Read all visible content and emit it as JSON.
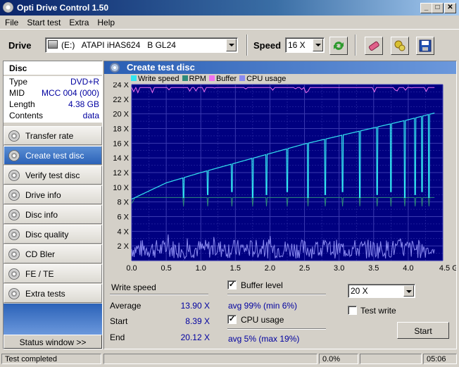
{
  "window": {
    "title": "Opti Drive Control 1.50",
    "controls": [
      "_",
      "□",
      "✕"
    ]
  },
  "menu": [
    "File",
    "Start test",
    "Extra",
    "Help"
  ],
  "toolbar": {
    "drive_label": "Drive",
    "drive_value": "(E:)   ATAPI iHAS624   B GL24",
    "speed_label": "Speed",
    "speed_value": "16 X"
  },
  "disc": {
    "header": "Disc",
    "rows": [
      {
        "key": "Type",
        "value": "DVD+R"
      },
      {
        "key": "MID",
        "value": "MCC 004 (000)"
      },
      {
        "key": "Length",
        "value": "4.38 GB"
      },
      {
        "key": "Contents",
        "value": "data"
      }
    ]
  },
  "nav": [
    {
      "label": "Transfer rate",
      "active": false
    },
    {
      "label": "Create test disc",
      "active": true
    },
    {
      "label": "Verify test disc",
      "active": false
    },
    {
      "label": "Drive info",
      "active": false
    },
    {
      "label": "Disc info",
      "active": false
    },
    {
      "label": "Disc quality",
      "active": false
    },
    {
      "label": "CD Bler",
      "active": false
    },
    {
      "label": "FE / TE",
      "active": false
    },
    {
      "label": "Extra tests",
      "active": false
    }
  ],
  "status_window_label": "Status window >>",
  "main": {
    "title": "Create test disc",
    "legend": [
      {
        "name": "Write speed",
        "color": "#33e5f0"
      },
      {
        "name": "RPM",
        "color": "#2e8a7a"
      },
      {
        "name": "Buffer",
        "color": "#f070f0"
      },
      {
        "name": "CPU usage",
        "color": "#8a8af0"
      }
    ]
  },
  "chart_data": {
    "type": "line",
    "x_axis": {
      "min": 0,
      "max": 4.5,
      "ticks": [
        "0.0",
        "0.5",
        "1.0",
        "1.5",
        "2.0",
        "2.5",
        "3.0",
        "3.5",
        "4.0",
        "4.5 GB"
      ]
    },
    "y_axis": {
      "min": 0,
      "max": 24,
      "ticks": [
        "2 X",
        "4 X",
        "6 X",
        "8 X",
        "10 X",
        "12 X",
        "14 X",
        "16 X",
        "18 X",
        "20 X",
        "22 X",
        "24 X"
      ]
    },
    "grid": true,
    "background": "#000080",
    "series": [
      {
        "name": "Write speed",
        "color": "#33e5f0",
        "x": [
          0.0,
          0.05,
          0.5,
          1.0,
          1.5,
          2.0,
          2.5,
          3.0,
          3.5,
          4.0,
          4.38
        ],
        "values": [
          8.39,
          8.6,
          10.6,
          12.0,
          13.3,
          14.6,
          15.9,
          17.0,
          18.1,
          19.2,
          20.12
        ]
      },
      {
        "name": "RPM",
        "color": "#2e8a7a",
        "x": [
          0.0,
          0.05,
          4.38
        ],
        "values": [
          7.8,
          8.6,
          8.6
        ]
      },
      {
        "name": "Buffer",
        "color": "#f070f0",
        "x": [
          0.0,
          4.38
        ],
        "values": [
          23.6,
          23.6
        ]
      },
      {
        "name": "CPU usage",
        "color": "#8a8af0",
        "x": [
          0.0,
          4.38
        ],
        "values": [
          1.2,
          1.2
        ]
      }
    ]
  },
  "stats": {
    "write_speed_label": "Write speed",
    "average_label": "Average",
    "average_value": "13.90 X",
    "start_label": "Start",
    "start_value": "8.39 X",
    "end_label": "End",
    "end_value": "20.12 X",
    "buffer_level_label": "Buffer level",
    "buffer_level_checked": true,
    "buffer_summary": "avg 99% (min 6%)",
    "cpu_usage_label": "CPU usage",
    "cpu_usage_checked": true,
    "cpu_summary": "avg 5% (max 19%)",
    "speed_select_value": "20 X",
    "test_write_label": "Test write",
    "test_write_checked": false,
    "start_button": "Start"
  },
  "statusbar": {
    "text": "Test completed",
    "progress": "0.0%",
    "time": "05:06"
  }
}
